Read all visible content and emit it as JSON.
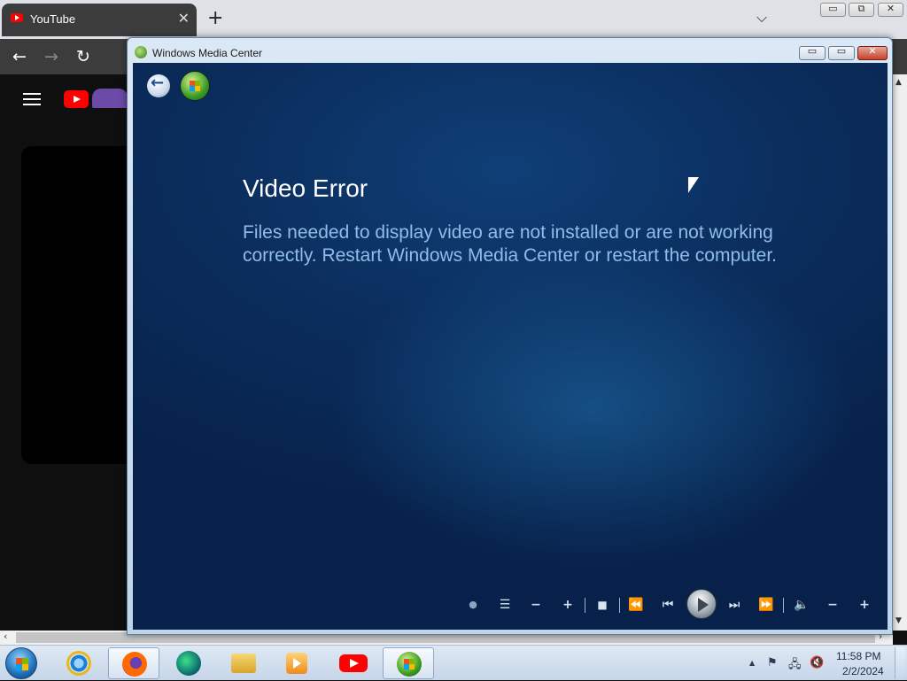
{
  "browser": {
    "tab_title": "YouTube",
    "tab_close": "✕",
    "new_tab": "+",
    "tab_menu": "⌵",
    "window_min": "▭",
    "window_restore": "⧉",
    "window_close": "✕",
    "nav_back": "←",
    "nav_forward": "→",
    "nav_reload": "↻"
  },
  "wmc": {
    "title": "Windows Media Center",
    "min": "▭",
    "max": "▭",
    "close": "✕",
    "error_title": "Video Error",
    "error_message": "Files needed to display video are not installed or are not working correctly. Restart Windows Media Center or restart the computer.",
    "transport": {
      "record": "●",
      "guide": "☰",
      "ch_down": "−",
      "ch_up": "+",
      "stop": "■",
      "rewind": "⏪",
      "prev": "⏮",
      "next": "⏭",
      "ffwd": "⏩",
      "mute": "🔈",
      "vol_down": "−",
      "vol_up": "+"
    }
  },
  "taskbar": {
    "items": [
      "Internet Explorer",
      "Firefox",
      "App",
      "Windows Explorer",
      "Windows Media Player",
      "YouTube",
      "Windows Media Center"
    ],
    "tray": {
      "show_hidden": "▲",
      "action_center": "⚑",
      "network": "🖧",
      "volume": "🔇",
      "time": "11:58 PM",
      "date": "2/2/2024"
    }
  },
  "colors": {
    "wmc_background": "#0b2e5e",
    "error_title": "#ffffff",
    "error_message": "#8fbde8",
    "youtube_red": "#ff0000"
  }
}
